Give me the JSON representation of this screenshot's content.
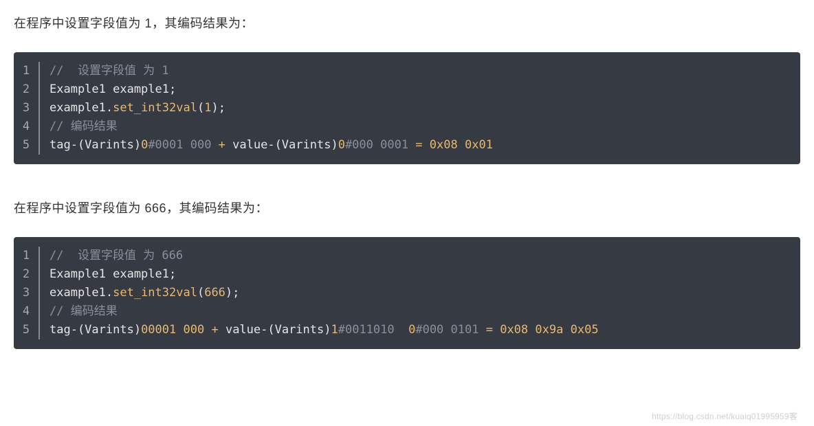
{
  "section1": {
    "text": "在程序中设置字段值为 1，其编码结果为："
  },
  "code1": {
    "lines": [
      {
        "n": "1",
        "segments": [
          {
            "cls": "tok-comment",
            "t": "//  设置字段值 为 1"
          }
        ]
      },
      {
        "n": "2",
        "segments": [
          {
            "cls": "tok-plain",
            "t": "Example1 example1;"
          }
        ]
      },
      {
        "n": "3",
        "segments": [
          {
            "cls": "tok-plain",
            "t": "example1."
          },
          {
            "cls": "tok-method",
            "t": "set_int32val"
          },
          {
            "cls": "tok-plain",
            "t": "("
          },
          {
            "cls": "tok-num",
            "t": "1"
          },
          {
            "cls": "tok-plain",
            "t": ");"
          }
        ]
      },
      {
        "n": "4",
        "segments": [
          {
            "cls": "tok-comment",
            "t": "// 编码结果"
          }
        ]
      },
      {
        "n": "5",
        "segments": [
          {
            "cls": "tok-plain",
            "t": "tag-(Varints)"
          },
          {
            "cls": "tok-num",
            "t": "0"
          },
          {
            "cls": "tok-comment",
            "t": "#0001 000 "
          },
          {
            "cls": "tok-op",
            "t": "+"
          },
          {
            "cls": "tok-plain",
            "t": " value-(Varints)"
          },
          {
            "cls": "tok-num",
            "t": "0"
          },
          {
            "cls": "tok-comment",
            "t": "#000 0001 "
          },
          {
            "cls": "tok-op",
            "t": "="
          },
          {
            "cls": "tok-plain",
            "t": " "
          },
          {
            "cls": "tok-num",
            "t": "0x08"
          },
          {
            "cls": "tok-plain",
            "t": " "
          },
          {
            "cls": "tok-num",
            "t": "0x01"
          }
        ]
      }
    ]
  },
  "section2": {
    "text": "在程序中设置字段值为 666，其编码结果为："
  },
  "code2": {
    "lines": [
      {
        "n": "1",
        "segments": [
          {
            "cls": "tok-comment",
            "t": "//  设置字段值 为 666"
          }
        ]
      },
      {
        "n": "2",
        "segments": [
          {
            "cls": "tok-plain",
            "t": "Example1 example1;"
          }
        ]
      },
      {
        "n": "3",
        "segments": [
          {
            "cls": "tok-plain",
            "t": "example1."
          },
          {
            "cls": "tok-method",
            "t": "set_int32val"
          },
          {
            "cls": "tok-plain",
            "t": "("
          },
          {
            "cls": "tok-num",
            "t": "666"
          },
          {
            "cls": "tok-plain",
            "t": ");"
          }
        ]
      },
      {
        "n": "4",
        "segments": [
          {
            "cls": "tok-comment",
            "t": "// 编码结果"
          }
        ]
      },
      {
        "n": "5",
        "segments": [
          {
            "cls": "tok-plain",
            "t": "tag-(Varints)"
          },
          {
            "cls": "tok-num",
            "t": "00001"
          },
          {
            "cls": "tok-plain",
            "t": " "
          },
          {
            "cls": "tok-num",
            "t": "000"
          },
          {
            "cls": "tok-plain",
            "t": " "
          },
          {
            "cls": "tok-op",
            "t": "+"
          },
          {
            "cls": "tok-plain",
            "t": " value-(Varints)"
          },
          {
            "cls": "tok-num",
            "t": "1"
          },
          {
            "cls": "tok-comment",
            "t": "#0011010  "
          },
          {
            "cls": "tok-num",
            "t": "0"
          },
          {
            "cls": "tok-comment",
            "t": "#000 0101 "
          },
          {
            "cls": "tok-op",
            "t": "="
          },
          {
            "cls": "tok-plain",
            "t": " "
          },
          {
            "cls": "tok-num",
            "t": "0x08"
          },
          {
            "cls": "tok-plain",
            "t": " "
          },
          {
            "cls": "tok-num",
            "t": "0x9a"
          },
          {
            "cls": "tok-plain",
            "t": " "
          },
          {
            "cls": "tok-num",
            "t": "0x05"
          }
        ]
      }
    ]
  },
  "watermark": "https://blog.csdn.net/kuaiq01995959客"
}
